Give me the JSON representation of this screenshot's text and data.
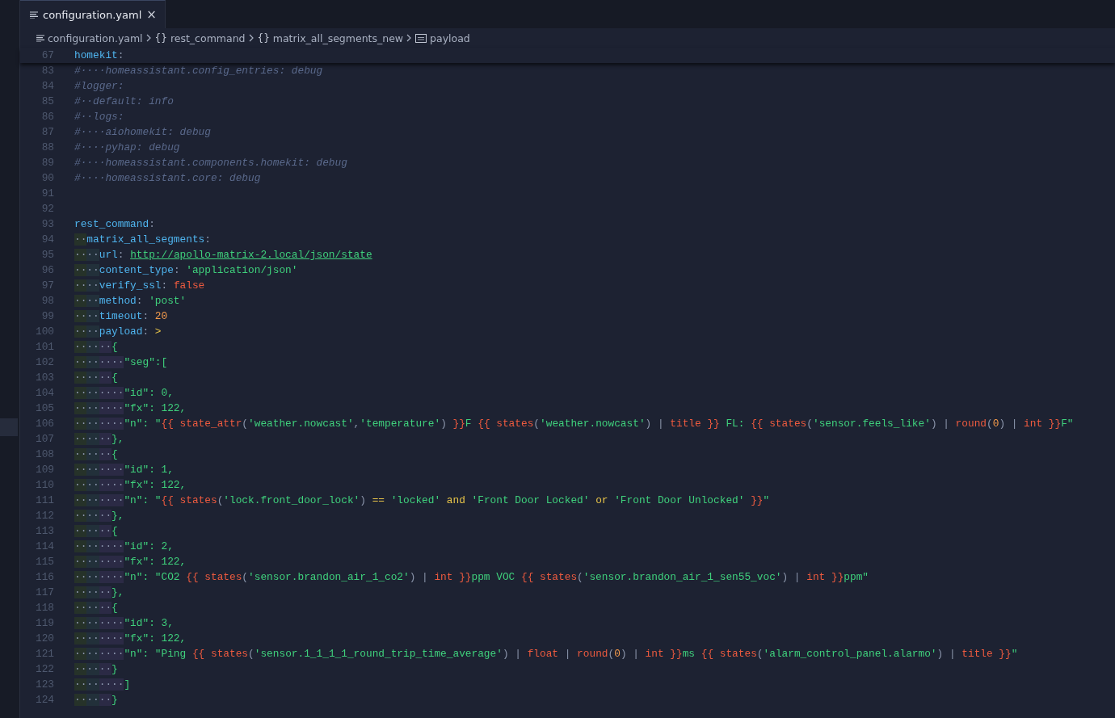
{
  "tab": {
    "label": "configuration.yaml",
    "selected": true,
    "close": "×"
  },
  "breadcrumbs": [
    {
      "kind": "file",
      "label": "configuration.yaml"
    },
    {
      "kind": "object",
      "icon": "{}",
      "label": "rest_command"
    },
    {
      "kind": "object",
      "icon": "{}",
      "label": "matrix_all_segments_new"
    },
    {
      "kind": "string",
      "label": "payload"
    }
  ],
  "sticky_line": {
    "number": "67",
    "tokens": [
      {
        "kind": "key",
        "text": "homekit"
      },
      {
        "kind": "punct",
        "text": ":"
      }
    ]
  },
  "lines": [
    {
      "number": "83",
      "tokens": [
        {
          "kind": "comment",
          "text": "#····homeassistant.config_entries: debug"
        }
      ]
    },
    {
      "number": "84",
      "tokens": [
        {
          "kind": "comment",
          "text": "#logger:"
        }
      ]
    },
    {
      "number": "85",
      "tokens": [
        {
          "kind": "comment",
          "text": "#··default: info"
        }
      ]
    },
    {
      "number": "86",
      "tokens": [
        {
          "kind": "comment",
          "text": "#··logs:"
        }
      ]
    },
    {
      "number": "87",
      "tokens": [
        {
          "kind": "comment",
          "text": "#····aiohomekit: debug"
        }
      ]
    },
    {
      "number": "88",
      "tokens": [
        {
          "kind": "comment",
          "text": "#····pyhap: debug"
        }
      ]
    },
    {
      "number": "89",
      "tokens": [
        {
          "kind": "comment",
          "text": "#····homeassistant.components.homekit: debug"
        }
      ]
    },
    {
      "number": "90",
      "tokens": [
        {
          "kind": "comment",
          "text": "#····homeassistant.core: debug"
        }
      ]
    },
    {
      "number": "91"
    },
    {
      "number": "92"
    },
    {
      "number": "93",
      "tokens": [
        {
          "kind": "key",
          "text": "rest_command"
        },
        {
          "kind": "punct",
          "text": ":"
        }
      ]
    },
    {
      "number": "94",
      "whitespace": "··",
      "tokens": [
        {
          "kind": "key",
          "text": "matrix_all_segments"
        },
        {
          "kind": "punct",
          "text": ":"
        }
      ]
    },
    {
      "number": "95",
      "whitespace": "····",
      "tokens": [
        {
          "kind": "key",
          "text": "url"
        },
        {
          "kind": "punct",
          "text": ": "
        },
        {
          "kind": "link",
          "text": "http://apollo-matrix-2.local/json/state"
        }
      ]
    },
    {
      "number": "96",
      "whitespace": "····",
      "tokens": [
        {
          "kind": "key",
          "text": "content_type"
        },
        {
          "kind": "punct",
          "text": ": "
        },
        {
          "kind": "string",
          "text": "'application/json'"
        }
      ]
    },
    {
      "number": "97",
      "whitespace": "····",
      "tokens": [
        {
          "kind": "key",
          "text": "verify_ssl"
        },
        {
          "kind": "punct",
          "text": ": "
        },
        {
          "kind": "template",
          "text": "false"
        }
      ]
    },
    {
      "number": "98",
      "whitespace": "····",
      "tokens": [
        {
          "kind": "key",
          "text": "method"
        },
        {
          "kind": "punct",
          "text": ": "
        },
        {
          "kind": "string",
          "text": "'post'"
        }
      ]
    },
    {
      "number": "99",
      "whitespace": "····",
      "tokens": [
        {
          "kind": "key",
          "text": "timeout"
        },
        {
          "kind": "punct",
          "text": ": "
        },
        {
          "kind": "number",
          "text": "20"
        }
      ]
    },
    {
      "number": "100",
      "whitespace": "····",
      "tokens": [
        {
          "kind": "key",
          "text": "payload"
        },
        {
          "kind": "punct",
          "text": ": "
        },
        {
          "kind": "keyword",
          "text": ">"
        }
      ]
    },
    {
      "number": "101",
      "whitespace": "······",
      "tokens": [
        {
          "kind": "string",
          "text": "{"
        }
      ]
    },
    {
      "number": "102",
      "whitespace": "········",
      "tokens": [
        {
          "kind": "string",
          "text": "\"seg\":["
        }
      ]
    },
    {
      "number": "103",
      "whitespace": "······",
      "tokens": [
        {
          "kind": "string",
          "text": "{"
        }
      ]
    },
    {
      "number": "104",
      "whitespace": "········",
      "tokens": [
        {
          "kind": "string",
          "text": "\"id\": "
        },
        {
          "kind": "string",
          "text": "0,"
        }
      ]
    },
    {
      "number": "105",
      "whitespace": "········",
      "tokens": [
        {
          "kind": "string",
          "text": "\"fx\": 122,"
        }
      ]
    },
    {
      "number": "106",
      "whitespace": "········",
      "tokens": [
        {
          "kind": "string",
          "text": "\"n\": \""
        },
        {
          "kind": "template",
          "text": "{{ state_attr"
        },
        {
          "kind": "punct",
          "text": "("
        },
        {
          "kind": "string",
          "text": "'weather.nowcast'"
        },
        {
          "kind": "punct",
          "text": ","
        },
        {
          "kind": "string",
          "text": "'temperature'"
        },
        {
          "kind": "punct",
          "text": ") "
        },
        {
          "kind": "template",
          "text": "}}"
        },
        {
          "kind": "string",
          "text": "F "
        },
        {
          "kind": "template",
          "text": "{{ states"
        },
        {
          "kind": "punct",
          "text": "("
        },
        {
          "kind": "string",
          "text": "'weather.nowcast'"
        },
        {
          "kind": "punct",
          "text": ") | "
        },
        {
          "kind": "template",
          "text": "title }}"
        },
        {
          "kind": "string",
          "text": " FL: "
        },
        {
          "kind": "template",
          "text": "{{ states"
        },
        {
          "kind": "punct",
          "text": "("
        },
        {
          "kind": "string",
          "text": "'sensor.feels_like'"
        },
        {
          "kind": "punct",
          "text": ") | "
        },
        {
          "kind": "template",
          "text": "round"
        },
        {
          "kind": "punct",
          "text": "("
        },
        {
          "kind": "number",
          "text": "0"
        },
        {
          "kind": "punct",
          "text": ") | "
        },
        {
          "kind": "template",
          "text": "int }}"
        },
        {
          "kind": "string",
          "text": "F\""
        }
      ]
    },
    {
      "number": "107",
      "whitespace": "······",
      "tokens": [
        {
          "kind": "string",
          "text": "},"
        }
      ]
    },
    {
      "number": "108",
      "whitespace": "······",
      "tokens": [
        {
          "kind": "string",
          "text": "{"
        }
      ]
    },
    {
      "number": "109",
      "whitespace": "········",
      "tokens": [
        {
          "kind": "string",
          "text": "\"id\": 1,"
        }
      ]
    },
    {
      "number": "110",
      "whitespace": "········",
      "tokens": [
        {
          "kind": "string",
          "text": "\"fx\": 122,"
        }
      ]
    },
    {
      "number": "111",
      "whitespace": "········",
      "tokens": [
        {
          "kind": "string",
          "text": "\"n\": \""
        },
        {
          "kind": "template",
          "text": "{{ states"
        },
        {
          "kind": "punct",
          "text": "("
        },
        {
          "kind": "string",
          "text": "'lock.front_door_lock'"
        },
        {
          "kind": "punct",
          "text": ") "
        },
        {
          "kind": "keyword",
          "text": "=="
        },
        {
          "kind": "string",
          "text": " 'locked' "
        },
        {
          "kind": "keyword",
          "text": "and"
        },
        {
          "kind": "string",
          "text": " 'Front Door Locked' "
        },
        {
          "kind": "keyword",
          "text": "or"
        },
        {
          "kind": "string",
          "text": " 'Front Door Unlocked' "
        },
        {
          "kind": "template",
          "text": "}}"
        },
        {
          "kind": "string",
          "text": "\""
        }
      ]
    },
    {
      "number": "112",
      "whitespace": "······",
      "tokens": [
        {
          "kind": "string",
          "text": "},"
        }
      ]
    },
    {
      "number": "113",
      "whitespace": "······",
      "tokens": [
        {
          "kind": "string",
          "text": "{"
        }
      ]
    },
    {
      "number": "114",
      "whitespace": "········",
      "tokens": [
        {
          "kind": "string",
          "text": "\"id\": 2,"
        }
      ]
    },
    {
      "number": "115",
      "whitespace": "········",
      "tokens": [
        {
          "kind": "string",
          "text": "\"fx\": 122,"
        }
      ]
    },
    {
      "number": "116",
      "whitespace": "········",
      "tokens": [
        {
          "kind": "string",
          "text": "\"n\": \"CO2 "
        },
        {
          "kind": "template",
          "text": "{{ states"
        },
        {
          "kind": "punct",
          "text": "("
        },
        {
          "kind": "string",
          "text": "'sensor.brandon_air_1_co2'"
        },
        {
          "kind": "punct",
          "text": ") | "
        },
        {
          "kind": "template",
          "text": "int }}"
        },
        {
          "kind": "string",
          "text": "ppm VOC "
        },
        {
          "kind": "template",
          "text": "{{ states"
        },
        {
          "kind": "punct",
          "text": "("
        },
        {
          "kind": "string",
          "text": "'sensor.brandon_air_1_sen55_voc'"
        },
        {
          "kind": "punct",
          "text": ") | "
        },
        {
          "kind": "template",
          "text": "int }}"
        },
        {
          "kind": "string",
          "text": "ppm\""
        }
      ]
    },
    {
      "number": "117",
      "whitespace": "······",
      "tokens": [
        {
          "kind": "string",
          "text": "},"
        }
      ]
    },
    {
      "number": "118",
      "whitespace": "······",
      "tokens": [
        {
          "kind": "string",
          "text": "{"
        }
      ]
    },
    {
      "number": "119",
      "whitespace": "········",
      "tokens": [
        {
          "kind": "string",
          "text": "\"id\": 3,"
        }
      ]
    },
    {
      "number": "120",
      "whitespace": "········",
      "tokens": [
        {
          "kind": "string",
          "text": "\"fx\": 122,"
        }
      ]
    },
    {
      "number": "121",
      "whitespace": "········",
      "tokens": [
        {
          "kind": "string",
          "text": "\"n\": \"Ping "
        },
        {
          "kind": "template",
          "text": "{{ states"
        },
        {
          "kind": "punct",
          "text": "("
        },
        {
          "kind": "string",
          "text": "'sensor.1_1_1_1_round_trip_time_average'"
        },
        {
          "kind": "punct",
          "text": ") | "
        },
        {
          "kind": "template",
          "text": "float"
        },
        {
          "kind": "punct",
          "text": " | "
        },
        {
          "kind": "template",
          "text": "round"
        },
        {
          "kind": "punct",
          "text": "("
        },
        {
          "kind": "number",
          "text": "0"
        },
        {
          "kind": "punct",
          "text": ") | "
        },
        {
          "kind": "template",
          "text": "int }}"
        },
        {
          "kind": "string",
          "text": "ms "
        },
        {
          "kind": "template",
          "text": "{{ states"
        },
        {
          "kind": "punct",
          "text": "("
        },
        {
          "kind": "string",
          "text": "'alarm_control_panel.alarmo'"
        },
        {
          "kind": "punct",
          "text": ") | "
        },
        {
          "kind": "template",
          "text": "title }}"
        },
        {
          "kind": "string",
          "text": "\""
        }
      ]
    },
    {
      "number": "122",
      "whitespace": "······",
      "tokens": [
        {
          "kind": "string",
          "text": "}"
        }
      ]
    },
    {
      "number": "123",
      "whitespace": "········",
      "tokens": [
        {
          "kind": "string",
          "text": "]"
        }
      ]
    },
    {
      "number": "124",
      "whitespace": "······",
      "tokens": [
        {
          "kind": "string",
          "text": "}"
        }
      ]
    }
  ]
}
